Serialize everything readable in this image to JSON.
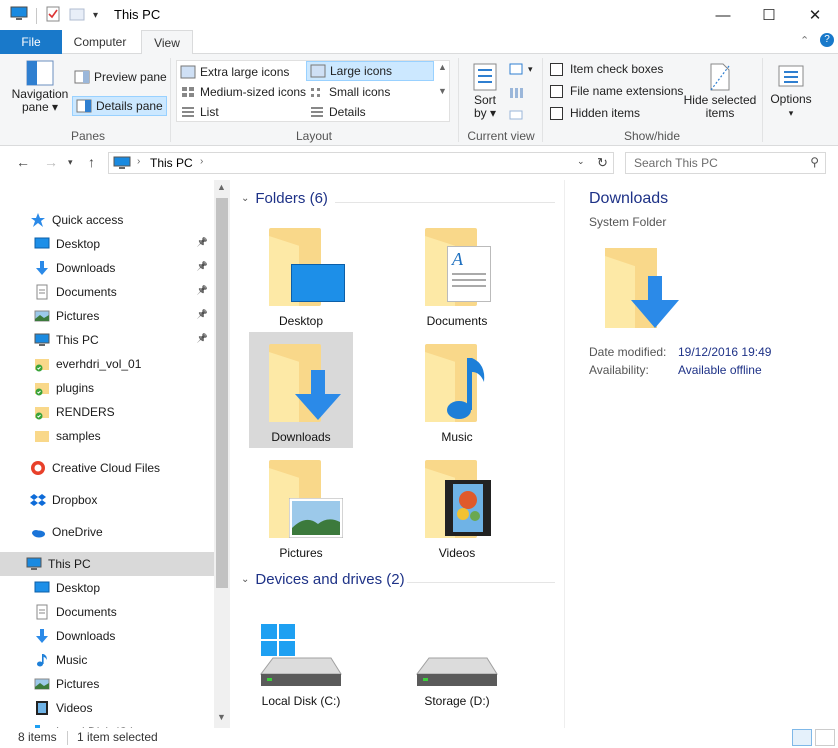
{
  "window": {
    "title": "This PC",
    "minimize": "—",
    "maximize": "☐",
    "close": "✕"
  },
  "ribbon": {
    "tabs": [
      "File",
      "Computer",
      "View"
    ],
    "panes": {
      "label": "Panes",
      "navigation_pane": "Navigation\npane ▾",
      "preview_pane": "Preview pane",
      "details_pane": "Details pane"
    },
    "layout": {
      "label": "Layout",
      "options": [
        "Extra large icons",
        "Large icons",
        "Medium-sized icons",
        "Small icons",
        "List",
        "Details"
      ],
      "selected": "Large icons"
    },
    "current_view": {
      "label": "Current view",
      "sort_by": "Sort\nby ▾"
    },
    "show_hide": {
      "label": "Show/hide",
      "item_check_boxes": "Item check boxes",
      "file_name_extensions": "File name extensions",
      "hidden_items": "Hidden items",
      "hide_selected_items": "Hide selected\nitems"
    },
    "options": "Options"
  },
  "address": {
    "path": "This PC",
    "search_placeholder": "Search This PC"
  },
  "nav": {
    "items": [
      {
        "label": "Quick access",
        "icon": "star-icon",
        "pinned": false
      },
      {
        "label": "Desktop",
        "icon": "desktop-icon",
        "pinned": true
      },
      {
        "label": "Downloads",
        "icon": "download-icon",
        "pinned": true
      },
      {
        "label": "Documents",
        "icon": "documents-icon",
        "pinned": true
      },
      {
        "label": "Pictures",
        "icon": "pictures-icon",
        "pinned": true
      },
      {
        "label": "This PC",
        "icon": "computer-icon",
        "pinned": true
      },
      {
        "label": "everhdri_vol_01",
        "icon": "folder-synced-icon",
        "pinned": false
      },
      {
        "label": "plugins",
        "icon": "folder-synced-icon",
        "pinned": false
      },
      {
        "label": "RENDERS",
        "icon": "folder-synced-icon",
        "pinned": false
      },
      {
        "label": "samples",
        "icon": "folder-icon",
        "pinned": false
      },
      {
        "label": "Creative Cloud Files",
        "icon": "creative-cloud-icon",
        "pinned": false
      },
      {
        "label": "Dropbox",
        "icon": "dropbox-icon",
        "pinned": false
      },
      {
        "label": "OneDrive",
        "icon": "onedrive-icon",
        "pinned": false
      },
      {
        "label": "This PC",
        "icon": "computer-icon",
        "pinned": false
      },
      {
        "label": "Desktop",
        "icon": "desktop-icon",
        "pinned": false
      },
      {
        "label": "Documents",
        "icon": "documents-icon",
        "pinned": false
      },
      {
        "label": "Downloads",
        "icon": "download-icon",
        "pinned": false
      },
      {
        "label": "Music",
        "icon": "music-icon",
        "pinned": false
      },
      {
        "label": "Pictures",
        "icon": "pictures-icon",
        "pinned": false
      },
      {
        "label": "Videos",
        "icon": "videos-icon",
        "pinned": false
      },
      {
        "label": "Local Disk (C:)",
        "icon": "drive-icon",
        "pinned": false
      }
    ],
    "selected": "This PC"
  },
  "content": {
    "folders_header": "Folders (6)",
    "devices_header": "Devices and drives (2)",
    "folders": [
      "Desktop",
      "Documents",
      "Downloads",
      "Music",
      "Pictures",
      "Videos"
    ],
    "selected_folder": "Downloads",
    "drives": [
      "Local Disk (C:)",
      "Storage (D:)"
    ]
  },
  "details": {
    "name": "Downloads",
    "type": "System Folder",
    "date_modified_label": "Date modified:",
    "date_modified": "19/12/2016 19:49",
    "availability_label": "Availability:",
    "availability": "Available offline"
  },
  "status": {
    "count": "8 items",
    "selection": "1 item selected"
  },
  "colors": {
    "accent": "#1979ca",
    "folder": "#f9d88a",
    "link_text": "#1e3287",
    "selection": "#d9d9d9",
    "ribbon_selected": "#cce8ff"
  }
}
